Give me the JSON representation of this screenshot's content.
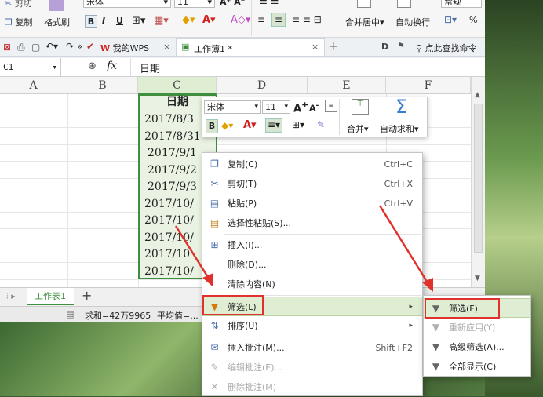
{
  "ribbon": {
    "cut": "剪切",
    "copy": "复制",
    "format_painter": "格式刷",
    "font_name": "宋体",
    "font_size": "11",
    "bold": "B",
    "italic": "I",
    "underline": "U",
    "merge_center": "合并居中",
    "wrap_text": "自动换行",
    "number_format": "常规",
    "percent": "%"
  },
  "tabbar": {
    "wps_tab": "我的WPS",
    "workbook_tab": "工作簿1 *",
    "search_command": "点此查找命令",
    "add_tab": "+"
  },
  "formula": {
    "name_box": "C1",
    "fx": "fx",
    "value": "日期"
  },
  "grid": {
    "columns": [
      "A",
      "B",
      "C",
      "D",
      "E",
      "F"
    ],
    "header_value": "日期",
    "dates": [
      "2017/8/3",
      "2017/8/31",
      "2017/9/1",
      "2017/9/2",
      "2017/9/3",
      "2017/10/",
      "2017/10/",
      "2017/10/",
      "2017/10",
      "2017/10/"
    ]
  },
  "sheet": {
    "tab": "工作表1",
    "add": "+"
  },
  "status": {
    "sum": "求和=42万9965",
    "avg": "平均值=..."
  },
  "mini_toolbar": {
    "font": "宋体",
    "size": "11",
    "grow": "A",
    "shrink": "A",
    "bold": "B",
    "merge": "合并",
    "autosum": "自动求和"
  },
  "context_menu": [
    {
      "label": "复制(C)",
      "shortcut": "Ctrl+C",
      "icon": "copy-icon",
      "disabled": false
    },
    {
      "label": "剪切(T)",
      "shortcut": "Ctrl+X",
      "icon": "scissors-icon",
      "disabled": false
    },
    {
      "label": "粘贴(P)",
      "shortcut": "Ctrl+V",
      "icon": "paste-icon",
      "disabled": false
    },
    {
      "label": "选择性粘贴(S)...",
      "shortcut": "",
      "icon": "paste-special-icon",
      "disabled": false
    },
    {
      "label": "插入(I)...",
      "shortcut": "",
      "icon": "insert-icon",
      "disabled": false
    },
    {
      "label": "删除(D)...",
      "shortcut": "",
      "icon": "",
      "disabled": false
    },
    {
      "label": "清除内容(N)",
      "shortcut": "",
      "icon": "",
      "disabled": false
    },
    {
      "label": "筛选(L)",
      "shortcut": "",
      "icon": "filter-icon",
      "disabled": false
    },
    {
      "label": "排序(U)",
      "shortcut": "",
      "icon": "sort-icon",
      "disabled": false
    },
    {
      "label": "插入批注(M)...",
      "shortcut": "Shift+F2",
      "icon": "comment-icon",
      "disabled": false
    },
    {
      "label": "编辑批注(E)...",
      "shortcut": "",
      "icon": "edit-comment-icon",
      "disabled": true
    },
    {
      "label": "删除批注(M)",
      "shortcut": "",
      "icon": "delete-comment-icon",
      "disabled": true
    }
  ],
  "submenu": [
    {
      "label": "筛选(F)",
      "disabled": false
    },
    {
      "label": "重新应用(Y)",
      "disabled": true
    },
    {
      "label": "高级筛选(A)...",
      "disabled": false
    },
    {
      "label": "全部显示(C)",
      "disabled": false
    }
  ],
  "colors": {
    "selection_border": "#3f8f3f",
    "highlight_bg": "#dfedd3",
    "annotation_red": "#e0312c",
    "menu_icon_blue": "#4a6ea8"
  }
}
